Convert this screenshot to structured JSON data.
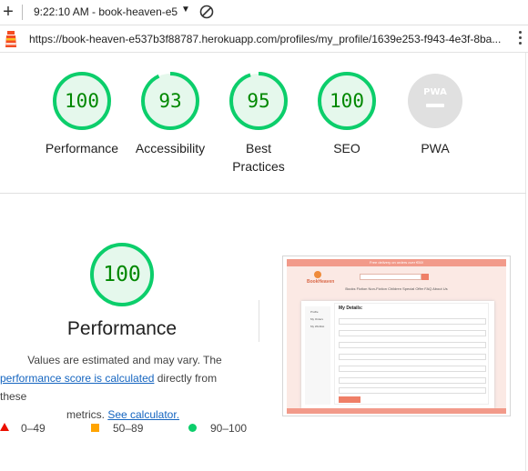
{
  "browser": {
    "new_tab_symbol": "+",
    "tab_title": "9:22:10 AM - book-heaven-e5",
    "tab_caret": "▼",
    "url": "https://book-heaven-e537b3f88787.herokuapp.com/profiles/my_profile/1639e253-f943-4e3f-8ba..."
  },
  "scores": [
    {
      "value": "100",
      "label": "Performance",
      "color": "#0cce6b"
    },
    {
      "value": "93",
      "label": "Accessibility",
      "color": "#0cce6b"
    },
    {
      "value": "95",
      "label": "Best Practices",
      "color": "#0cce6b"
    },
    {
      "value": "100",
      "label": "SEO",
      "color": "#0cce6b"
    },
    {
      "value": "PWA",
      "label": "PWA",
      "color": "#cccccc"
    }
  ],
  "performance": {
    "score": "100",
    "title": "Performance",
    "desc_line1": "Values are estimated and may vary. The",
    "desc_link1": "performance score is calculated",
    "desc_line2_tail": " directly from these",
    "desc_line3_head": "metrics. ",
    "desc_link2": "See calculator."
  },
  "legend": [
    {
      "range": "0–49",
      "color": "#eb0f00"
    },
    {
      "range": "50–89",
      "color": "#ffa400"
    },
    {
      "range": "90–100",
      "color": "#0cce6b"
    }
  ],
  "thumbnail": {
    "promo": "Free delivery on orders over €50!",
    "brand": "BookHeaven",
    "nav": "Books   Fiction   Non-Fiction   Children   Special Offer   FAQ   About Us",
    "side_items": [
      "Profile",
      "My Orders",
      "My Wishlist"
    ],
    "form_title": "My Details:"
  }
}
